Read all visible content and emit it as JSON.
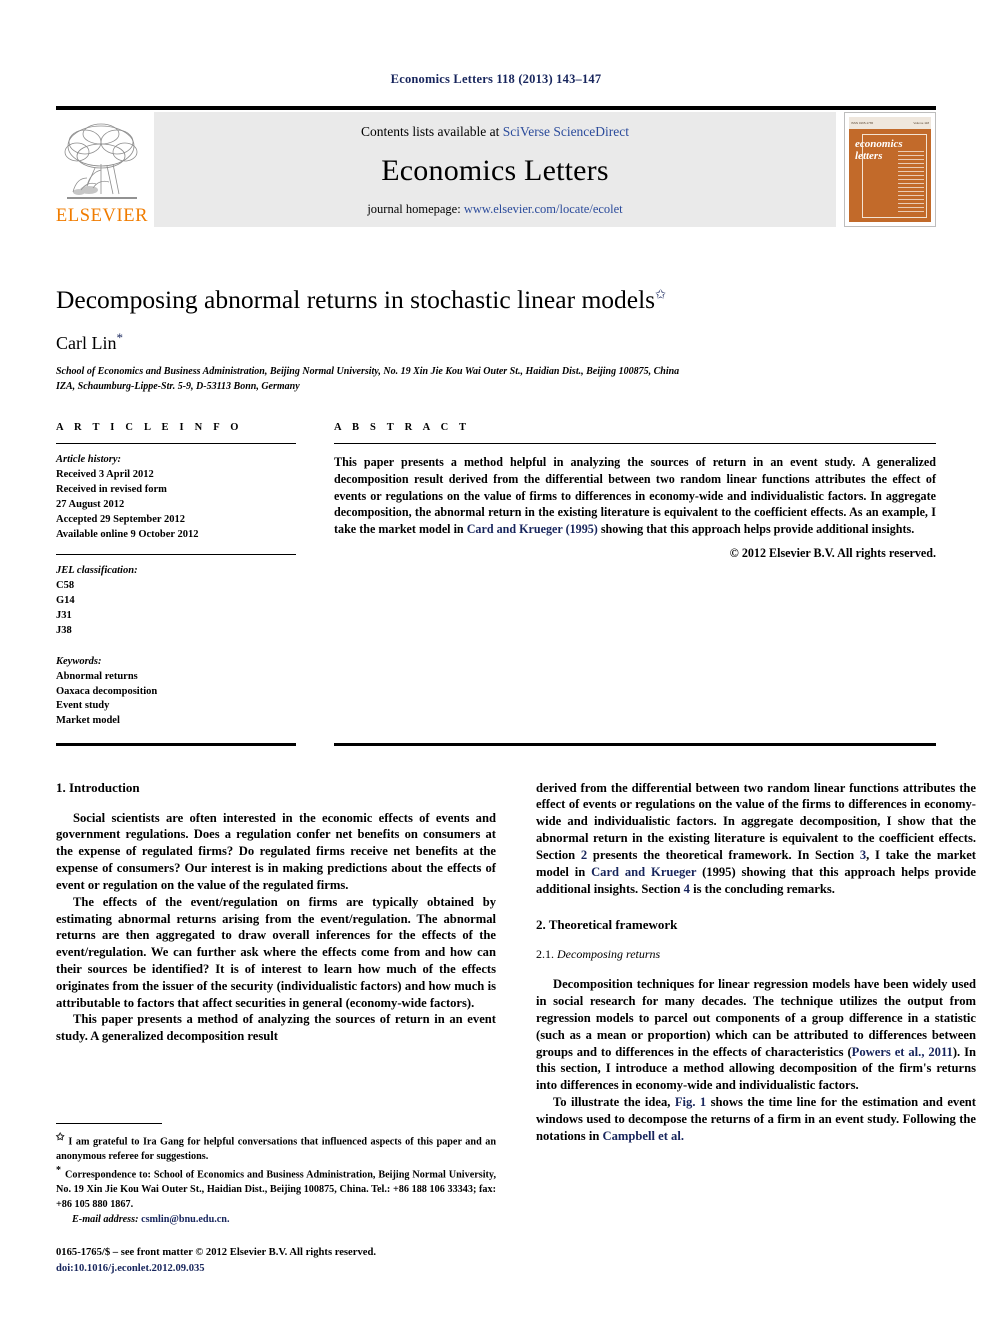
{
  "running_head": "Economics Letters 118 (2013) 143–147",
  "masthead": {
    "publisher_name": "ELSEVIER",
    "contents_prefix": "Contents lists available at ",
    "contents_link": "SciVerse ScienceDirect",
    "journal_title": "Economics Letters",
    "homepage_prefix": "journal homepage: ",
    "homepage_url": "www.elsevier.com/locate/ecolet",
    "cover": {
      "line1": "economics",
      "line2": "letters",
      "top_left": "ISSN 0165-1765",
      "top_right": "Volume 118"
    }
  },
  "article": {
    "title": "Decomposing abnormal returns in stochastic linear models",
    "title_marker": "✩",
    "author": "Carl Lin",
    "author_marker": "*",
    "affiliations": [
      "School of Economics and Business Administration, Beijing Normal University, No. 19 Xin Jie Kou Wai Outer St., Haidian Dist., Beijing 100875, China",
      "IZA, Schaumburg-Lippe-Str. 5-9, D-53113 Bonn, Germany"
    ]
  },
  "article_info": {
    "heading": "A R T I C L E   I N F O",
    "history_label": "Article history:",
    "history": [
      "Received 3 April 2012",
      "Received in revised form",
      "27 August 2012",
      "Accepted 29 September 2012",
      "Available online 9 October 2012"
    ],
    "jel_label": "JEL classification:",
    "jel_codes": [
      "C58",
      "G14",
      "J31",
      "J38"
    ],
    "keywords_label": "Keywords:",
    "keywords": [
      "Abnormal returns",
      "Oaxaca decomposition",
      "Event study",
      "Market model"
    ]
  },
  "abstract": {
    "heading": "A B S T R A C T",
    "text_part1": "This paper presents a method helpful in analyzing the sources of return in an event study. A generalized decomposition result derived from the differential between two random linear functions attributes the effect of events or regulations on the value of firms to differences in economy-wide and individualistic factors. In aggregate decomposition, the abnormal return in the existing literature is equivalent to the coefficient effects. As an example, I take the market model in ",
    "citation": "Card and Krueger",
    "citation_year": " (1995)",
    "text_part2": " showing that this approach helps provide additional insights.",
    "copyright": "© 2012 Elsevier B.V. All rights reserved."
  },
  "body": {
    "intro_heading": "1.  Introduction",
    "intro_p1": "Social scientists are often interested in the economic effects of events and government regulations. Does a regulation confer net benefits on consumers at the expense of regulated firms? Do regulated firms receive net benefits at the expense of consumers? Our interest is in making predictions about the effects of event or regulation on the value of the regulated firms.",
    "intro_p2": "The effects of the event/regulation on firms are typically obtained by estimating abnormal returns arising from the event/regulation. The abnormal returns are then aggregated to draw overall inferences for the effects of the event/regulation. We can further ask where the effects come from and how can their sources be identified? It is of interest to learn how much of the effects originates from the issuer of the security (individualistic factors) and how much is attributable to factors that affect securities in general (economy-wide factors).",
    "intro_p3": "This paper presents a method of analyzing the sources of return in an event study. A generalized decomposition result",
    "right_p1_a": "derived from the differential between two random linear functions attributes the effect of events or regulations on the value of the firms to differences in economy-wide and individualistic factors. In aggregate decomposition, I show that the abnormal return in the existing literature is equivalent to the coefficient effects. Section ",
    "right_p1_ref1": "2",
    "right_p1_b": " presents the theoretical framework. In Section ",
    "right_p1_ref2": "3",
    "right_p1_c": ", I take the market model in ",
    "right_p1_ref3": "Card and Krueger",
    "right_p1_d": " (1995) showing that this approach helps provide additional insights. Section ",
    "right_p1_ref4": "4",
    "right_p1_e": " is the concluding remarks.",
    "theory_heading": "2.  Theoretical framework",
    "subsec_num": "2.1. ",
    "subsec_title": "Decomposing returns",
    "theory_p1_a": "Decomposition techniques for linear regression models have been widely used in social research for many decades. The technique utilizes the output from regression models to parcel out components of a group difference in a statistic (such as a mean or proportion) which can be attributed to differences between groups and to differences in the effects of characteristics (",
    "theory_p1_ref": "Powers et al., 2011",
    "theory_p1_b": "). In this section, I introduce a method allowing decomposition of the firm's returns into differences in economy-wide and individualistic factors.",
    "theory_p2_a": "To illustrate the idea, ",
    "theory_p2_ref1": "Fig. 1",
    "theory_p2_b": " shows the time line for the estimation and event windows used to decompose the returns of a firm in an event study. Following the notations in ",
    "theory_p2_ref2": "Campbell et al."
  },
  "footnotes": {
    "fn1_marker": "✩",
    "fn1": "I am grateful to Ira Gang for helpful conversations that influenced aspects of this paper and an anonymous referee for suggestions.",
    "fn2_marker": "*",
    "fn2": "Correspondence to: School of Economics and Business Administration, Beijing Normal University, No. 19 Xin Jie Kou Wai Outer St., Haidian Dist., Beijing 100875, China. Tel.: +86 188 106 33343; fax: +86 105 880 1867.",
    "email_label": "E-mail address: ",
    "email": "csmlin@bnu.edu.cn."
  },
  "colophon": {
    "issn_line": "0165-1765/$ – see front matter © 2012 Elsevier B.V. All rights reserved.",
    "doi_line": "doi:10.1016/j.econlet.2012.09.035"
  }
}
